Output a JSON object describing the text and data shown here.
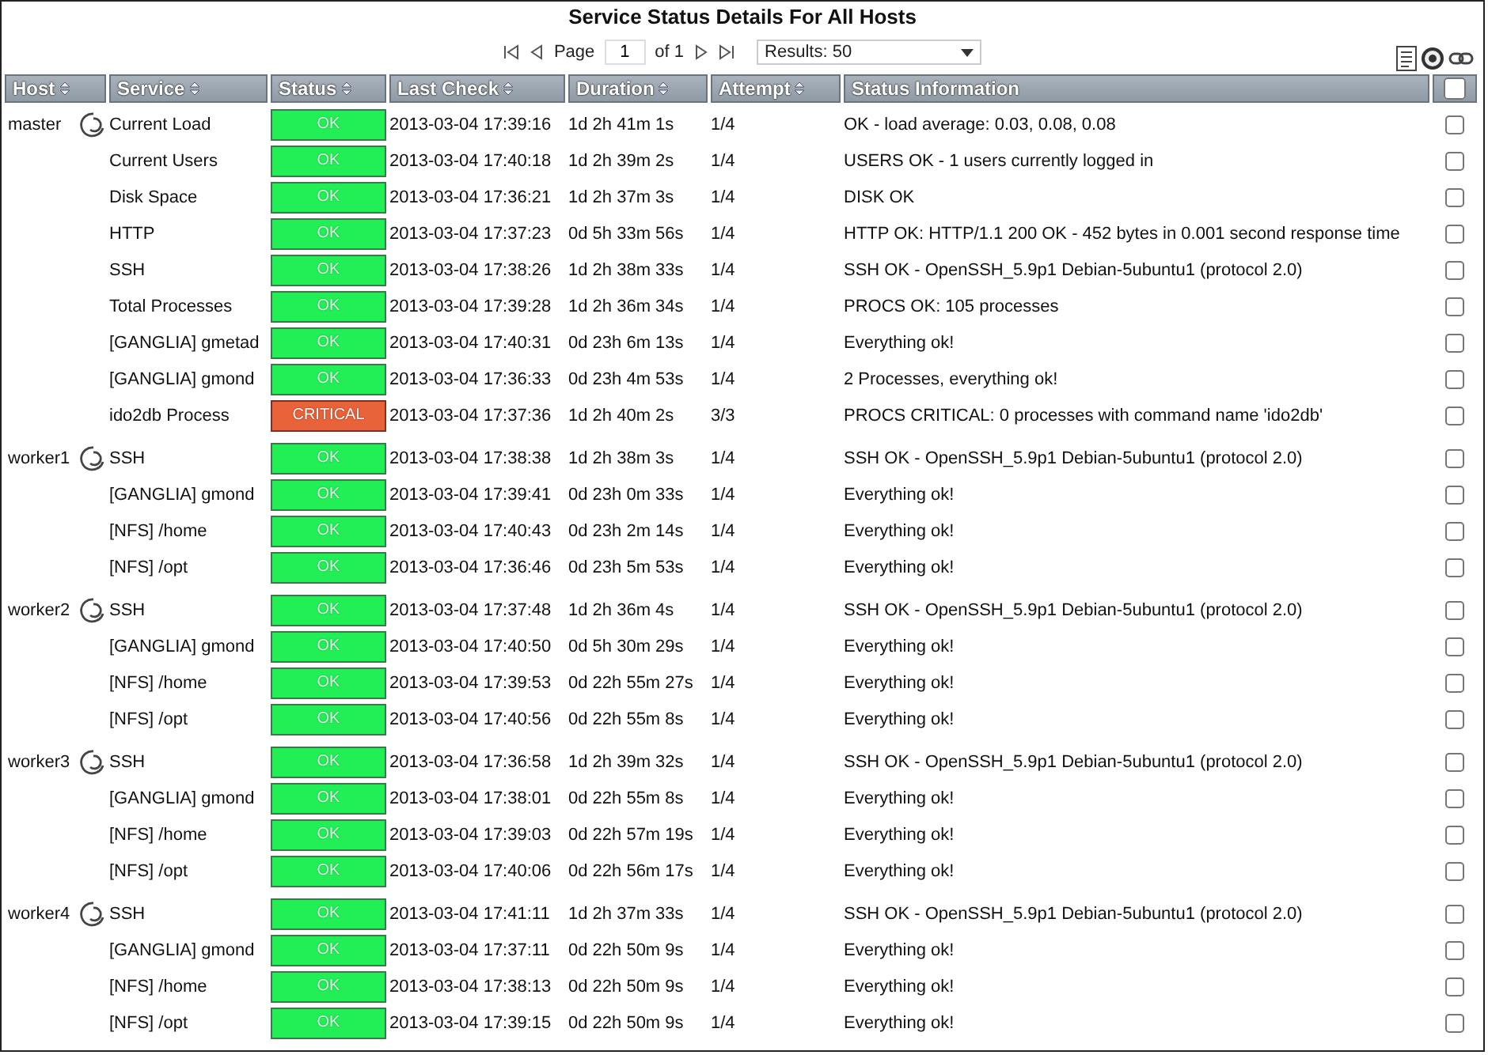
{
  "title": "Service Status Details For All Hosts",
  "pager": {
    "page_label": "Page",
    "page_value": "1",
    "of_label": "of 1",
    "results": "Results: 50"
  },
  "table": {
    "columns": [
      {
        "label": "Host",
        "sortable": true
      },
      {
        "label": "Service",
        "sortable": true
      },
      {
        "label": "Status",
        "sortable": true
      },
      {
        "label": "Last Check",
        "sortable": true
      },
      {
        "label": "Duration",
        "sortable": true
      },
      {
        "label": "Attempt",
        "sortable": true
      },
      {
        "label": "Status Information",
        "sortable": false
      }
    ],
    "select_all_checked": false,
    "hosts": [
      {
        "name": "master",
        "services": [
          {
            "service": "Current Load",
            "kind": "ok",
            "status": "OK",
            "last_check": "2013-03-04 17:39:16",
            "duration": "1d 2h 41m 1s",
            "attempt": "1/4",
            "info": "OK - load average: 0.03, 0.08, 0.08",
            "checked": false
          },
          {
            "service": "Current Users",
            "kind": "ok",
            "status": "OK",
            "last_check": "2013-03-04 17:40:18",
            "duration": "1d 2h 39m 2s",
            "attempt": "1/4",
            "info": "USERS OK - 1 users currently logged in",
            "checked": false
          },
          {
            "service": "Disk Space",
            "kind": "ok",
            "status": "OK",
            "last_check": "2013-03-04 17:36:21",
            "duration": "1d 2h 37m 3s",
            "attempt": "1/4",
            "info": "DISK OK",
            "checked": false
          },
          {
            "service": "HTTP",
            "kind": "ok",
            "status": "OK",
            "last_check": "2013-03-04 17:37:23",
            "duration": "0d 5h 33m 56s",
            "attempt": "1/4",
            "info": "HTTP OK: HTTP/1.1 200 OK - 452 bytes in 0.001 second response time",
            "checked": false
          },
          {
            "service": "SSH",
            "kind": "ok",
            "status": "OK",
            "last_check": "2013-03-04 17:38:26",
            "duration": "1d 2h 38m 33s",
            "attempt": "1/4",
            "info": "SSH OK - OpenSSH_5.9p1 Debian-5ubuntu1 (protocol 2.0)",
            "checked": false
          },
          {
            "service": "Total Processes",
            "kind": "ok",
            "status": "OK",
            "last_check": "2013-03-04 17:39:28",
            "duration": "1d 2h 36m 34s",
            "attempt": "1/4",
            "info": "PROCS OK: 105 processes",
            "checked": false
          },
          {
            "service": "[GANGLIA] gmetad",
            "kind": "ok",
            "status": "OK",
            "last_check": "2013-03-04 17:40:31",
            "duration": "0d 23h 6m 13s",
            "attempt": "1/4",
            "info": "Everything ok!",
            "checked": false
          },
          {
            "service": "[GANGLIA] gmond",
            "kind": "ok",
            "status": "OK",
            "last_check": "2013-03-04 17:36:33",
            "duration": "0d 23h 4m 53s",
            "attempt": "1/4",
            "info": "2 Processes, everything ok!",
            "checked": false
          },
          {
            "service": "ido2db Process",
            "kind": "critical",
            "status": "CRITICAL",
            "last_check": "2013-03-04 17:37:36",
            "duration": "1d 2h 40m 2s",
            "attempt": "3/3",
            "info": "PROCS CRITICAL: 0 processes with command name 'ido2db'",
            "checked": false
          }
        ]
      },
      {
        "name": "worker1",
        "services": [
          {
            "service": "SSH",
            "kind": "ok",
            "status": "OK",
            "last_check": "2013-03-04 17:38:38",
            "duration": "1d 2h 38m 3s",
            "attempt": "1/4",
            "info": "SSH OK - OpenSSH_5.9p1 Debian-5ubuntu1 (protocol 2.0)",
            "checked": false
          },
          {
            "service": "[GANGLIA] gmond",
            "kind": "ok",
            "status": "OK",
            "last_check": "2013-03-04 17:39:41",
            "duration": "0d 23h 0m 33s",
            "attempt": "1/4",
            "info": "Everything ok!",
            "checked": false
          },
          {
            "service": "[NFS] /home",
            "kind": "ok",
            "status": "OK",
            "last_check": "2013-03-04 17:40:43",
            "duration": "0d 23h 2m 14s",
            "attempt": "1/4",
            "info": "Everything ok!",
            "checked": false
          },
          {
            "service": "[NFS] /opt",
            "kind": "ok",
            "status": "OK",
            "last_check": "2013-03-04 17:36:46",
            "duration": "0d 23h 5m 53s",
            "attempt": "1/4",
            "info": "Everything ok!",
            "checked": false
          }
        ]
      },
      {
        "name": "worker2",
        "services": [
          {
            "service": "SSH",
            "kind": "ok",
            "status": "OK",
            "last_check": "2013-03-04 17:37:48",
            "duration": "1d 2h 36m 4s",
            "attempt": "1/4",
            "info": "SSH OK - OpenSSH_5.9p1 Debian-5ubuntu1 (protocol 2.0)",
            "checked": false
          },
          {
            "service": "[GANGLIA] gmond",
            "kind": "ok",
            "status": "OK",
            "last_check": "2013-03-04 17:40:50",
            "duration": "0d 5h 30m 29s",
            "attempt": "1/4",
            "info": "Everything ok!",
            "checked": false
          },
          {
            "service": "[NFS] /home",
            "kind": "ok",
            "status": "OK",
            "last_check": "2013-03-04 17:39:53",
            "duration": "0d 22h 55m 27s",
            "attempt": "1/4",
            "info": "Everything ok!",
            "checked": false
          },
          {
            "service": "[NFS] /opt",
            "kind": "ok",
            "status": "OK",
            "last_check": "2013-03-04 17:40:56",
            "duration": "0d 22h 55m 8s",
            "attempt": "1/4",
            "info": "Everything ok!",
            "checked": false
          }
        ]
      },
      {
        "name": "worker3",
        "services": [
          {
            "service": "SSH",
            "kind": "ok",
            "status": "OK",
            "last_check": "2013-03-04 17:36:58",
            "duration": "1d 2h 39m 32s",
            "attempt": "1/4",
            "info": "SSH OK - OpenSSH_5.9p1 Debian-5ubuntu1 (protocol 2.0)",
            "checked": false
          },
          {
            "service": "[GANGLIA] gmond",
            "kind": "ok",
            "status": "OK",
            "last_check": "2013-03-04 17:38:01",
            "duration": "0d 22h 55m 8s",
            "attempt": "1/4",
            "info": "Everything ok!",
            "checked": false
          },
          {
            "service": "[NFS] /home",
            "kind": "ok",
            "status": "OK",
            "last_check": "2013-03-04 17:39:03",
            "duration": "0d 22h 57m 19s",
            "attempt": "1/4",
            "info": "Everything ok!",
            "checked": false
          },
          {
            "service": "[NFS] /opt",
            "kind": "ok",
            "status": "OK",
            "last_check": "2013-03-04 17:40:06",
            "duration": "0d 22h 56m 17s",
            "attempt": "1/4",
            "info": "Everything ok!",
            "checked": false
          }
        ]
      },
      {
        "name": "worker4",
        "services": [
          {
            "service": "SSH",
            "kind": "ok",
            "status": "OK",
            "last_check": "2013-03-04 17:41:11",
            "duration": "1d 2h 37m 33s",
            "attempt": "1/4",
            "info": "SSH OK - OpenSSH_5.9p1 Debian-5ubuntu1 (protocol 2.0)",
            "checked": false
          },
          {
            "service": "[GANGLIA] gmond",
            "kind": "ok",
            "status": "OK",
            "last_check": "2013-03-04 17:37:11",
            "duration": "0d 22h 50m 9s",
            "attempt": "1/4",
            "info": "Everything ok!",
            "checked": false
          },
          {
            "service": "[NFS] /home",
            "kind": "ok",
            "status": "OK",
            "last_check": "2013-03-04 17:38:13",
            "duration": "0d 22h 50m 9s",
            "attempt": "1/4",
            "info": "Everything ok!",
            "checked": false
          },
          {
            "service": "[NFS] /opt",
            "kind": "ok",
            "status": "OK",
            "last_check": "2013-03-04 17:39:15",
            "duration": "0d 22h 50m 9s",
            "attempt": "1/4",
            "info": "Everything ok!",
            "checked": false
          }
        ]
      }
    ]
  }
}
